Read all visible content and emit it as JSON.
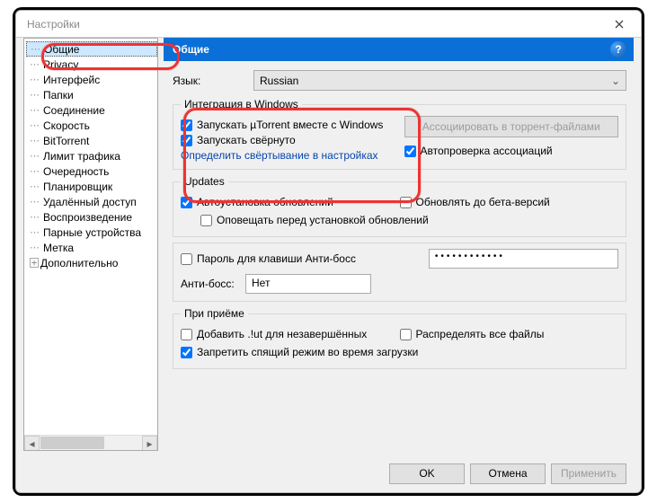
{
  "window": {
    "title": "Настройки",
    "close_x": "✕"
  },
  "sidebar": {
    "items": [
      "Общие",
      "Privacy",
      "Интерфейс",
      "Папки",
      "Соединение",
      "Скорость",
      "BitTorrent",
      "Лимит трафика",
      "Очередность",
      "Планировщик",
      "Удалённый доступ",
      "Воспроизведение",
      "Парные устройства",
      "Метка",
      "Дополнительно"
    ]
  },
  "content": {
    "heading": "Общие",
    "help": "?",
    "language": {
      "label": "Язык:",
      "value": "Russian"
    },
    "integration": {
      "legend": "Интеграция в Windows",
      "start_with_windows": "Запускать µTorrent вместе с Windows",
      "start_minimized": "Запускать свёрнуто",
      "minimize_setting": "Определить свёртывание в настройках",
      "associate_btn": "Ассоциировать в торрент-файлами",
      "autocheck": "Автопроверка ассоциаций"
    },
    "updates": {
      "legend": "Updates",
      "auto_update": "Автоустановка обновлений",
      "beta": "Обновлять до бета-версий",
      "notify": "Оповещать перед установкой обновлений"
    },
    "antiboss": {
      "password_chk": "Пароль для клавиши Анти-босс",
      "password_value": "••••••••••••",
      "label": "Анти-босс:",
      "value": "Нет"
    },
    "receive": {
      "legend": "При приёме",
      "add_ut": "Добавить .!ut для незавершённых",
      "prealloc": "Распределять все файлы",
      "no_standby": "Запретить спящий режим во время загрузки"
    }
  },
  "footer": {
    "ok": "OK",
    "cancel": "Отмена",
    "apply": "Применить"
  }
}
